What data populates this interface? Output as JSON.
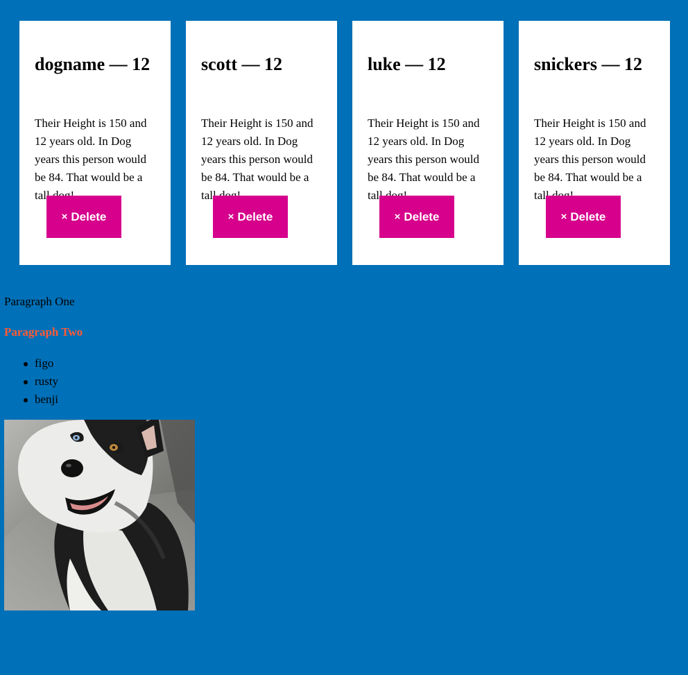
{
  "cards": [
    {
      "title": "dogname — 12",
      "text": "Their Height is 150 and 12 years old. In Dog years this person would be 84. That would be a tall dog!",
      "button_icon": "×",
      "button_label": "Delete"
    },
    {
      "title": "scott — 12",
      "text": "Their Height is 150 and 12 years old. In Dog years this person would be 84. That would be a tall dog!",
      "button_icon": "×",
      "button_label": "Delete"
    },
    {
      "title": "luke — 12",
      "text": "Their Height is 150 and 12 years old. In Dog years this person would be 84. That would be a tall dog!",
      "button_icon": "×",
      "button_label": "Delete"
    },
    {
      "title": "snickers — 12",
      "text": "Their Height is 150 and 12 years old. In Dog years this person would be 84. That would be a tall dog!",
      "button_icon": "×",
      "button_label": "Delete"
    }
  ],
  "paragraph_one": "Paragraph One",
  "paragraph_two": "Paragraph Two",
  "dog_list": [
    "figo",
    "rusty",
    "benji"
  ],
  "colors": {
    "background": "#0070b8",
    "card": "#ffffff",
    "delete_button": "#d6008c",
    "paragraph_two": "#ff5a36"
  },
  "image": {
    "icon": "husky-dog-photo"
  }
}
